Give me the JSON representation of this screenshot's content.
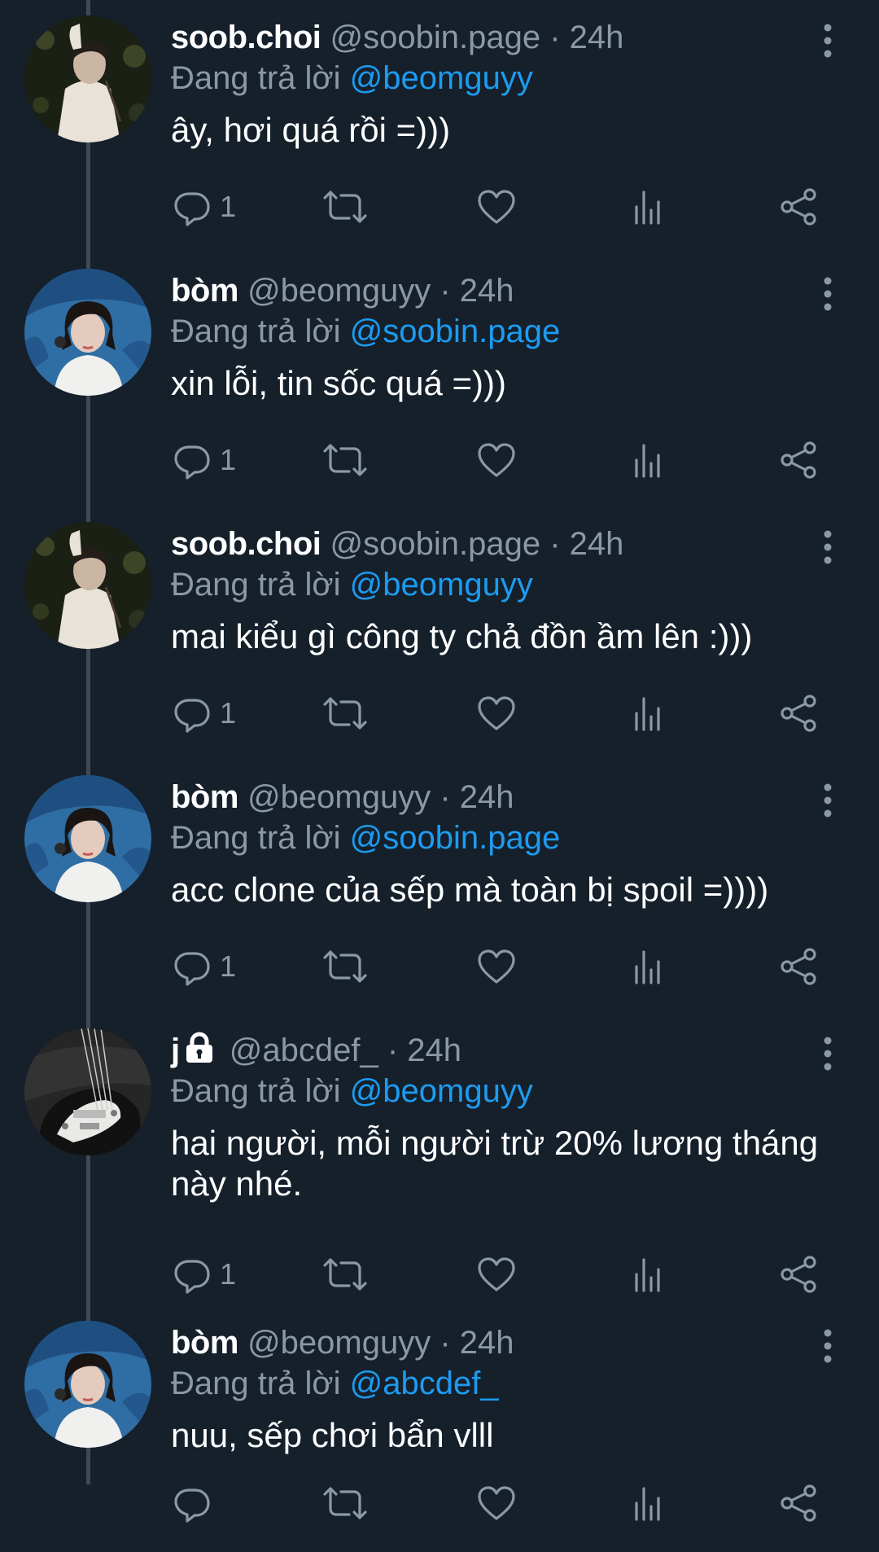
{
  "tweets": [
    {
      "avatar": "avatar-soob",
      "name": "soob.choi",
      "handle": "@soobin.page",
      "time": "· 24h",
      "locked": false,
      "reply_prefix": "Đang trả lời",
      "reply_to": "@beomguyy",
      "text": "ây, hơi quá rồi =)))",
      "reply_count": "1"
    },
    {
      "avatar": "avatar-bom",
      "name": "bòm",
      "handle": "@beomguyy",
      "time": "· 24h",
      "locked": false,
      "reply_prefix": "Đang trả lời",
      "reply_to": "@soobin.page",
      "text": "xin lỗi, tin sốc quá =)))",
      "reply_count": "1"
    },
    {
      "avatar": "avatar-soob",
      "name": "soob.choi",
      "handle": "@soobin.page",
      "time": "· 24h",
      "locked": false,
      "reply_prefix": "Đang trả lời",
      "reply_to": "@beomguyy",
      "text": "mai kiểu gì công ty chả đồn ầm lên :)))",
      "reply_count": "1"
    },
    {
      "avatar": "avatar-bom",
      "name": "bòm",
      "handle": "@beomguyy",
      "time": "· 24h",
      "locked": false,
      "reply_prefix": "Đang trả lời",
      "reply_to": "@soobin.page",
      "text": "acc clone của sếp mà toàn bị spoil =))))",
      "reply_count": "1"
    },
    {
      "avatar": "avatar-guitar",
      "name": "j",
      "handle": "@abcdef_",
      "time": "· 24h",
      "locked": true,
      "reply_prefix": "Đang trả lời",
      "reply_to": "@beomguyy",
      "text": "hai người, mỗi người trừ 20% lương tháng này nhé.",
      "reply_count": "1"
    },
    {
      "avatar": "avatar-bom",
      "name": "bòm",
      "handle": "@beomguyy",
      "time": "· 24h",
      "locked": false,
      "reply_prefix": "Đang trả lời",
      "reply_to": "@abcdef_",
      "text": "nuu, sếp chơi bẩn vlll",
      "reply_count": ""
    }
  ],
  "icons": {
    "reply": "reply-icon",
    "retweet": "retweet-icon",
    "like": "like-icon",
    "views": "views-icon",
    "share": "share-icon",
    "more": "more-icon",
    "lock": "lock-icon"
  },
  "colors": {
    "background": "#15202b",
    "text": "#ffffff",
    "muted": "#8b98a5",
    "link": "#1d9bf0",
    "thread": "#3d4a56"
  }
}
